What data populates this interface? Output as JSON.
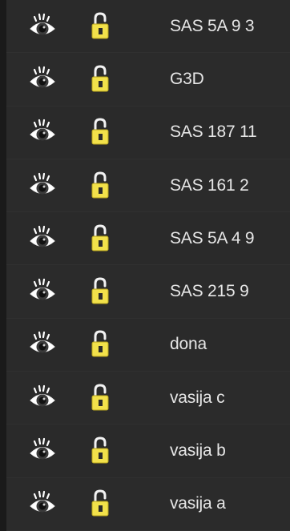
{
  "layers_panel": {
    "layers": [
      {
        "name": "SAS 5A 9 3",
        "visible_icon": "eye-icon",
        "lock_icon": "unlocked-padlock-icon"
      },
      {
        "name": "G3D",
        "visible_icon": "eye-icon",
        "lock_icon": "unlocked-padlock-icon"
      },
      {
        "name": "SAS 187 11",
        "visible_icon": "eye-icon",
        "lock_icon": "unlocked-padlock-icon"
      },
      {
        "name": "SAS 161 2",
        "visible_icon": "eye-icon",
        "lock_icon": "unlocked-padlock-icon"
      },
      {
        "name": "SAS 5A 4 9",
        "visible_icon": "eye-icon",
        "lock_icon": "unlocked-padlock-icon"
      },
      {
        "name": "SAS 215 9",
        "visible_icon": "eye-icon",
        "lock_icon": "unlocked-padlock-icon"
      },
      {
        "name": "dona",
        "visible_icon": "eye-icon",
        "lock_icon": "unlocked-padlock-icon"
      },
      {
        "name": "vasija c",
        "visible_icon": "eye-icon",
        "lock_icon": "unlocked-padlock-icon"
      },
      {
        "name": "vasija b",
        "visible_icon": "eye-icon",
        "lock_icon": "unlocked-padlock-icon"
      },
      {
        "name": "vasija a",
        "visible_icon": "eye-icon",
        "lock_icon": "unlocked-padlock-icon"
      }
    ]
  },
  "colors": {
    "background": "#262626",
    "text": "#e6e6e6",
    "lock_body": "#f2e14a"
  }
}
